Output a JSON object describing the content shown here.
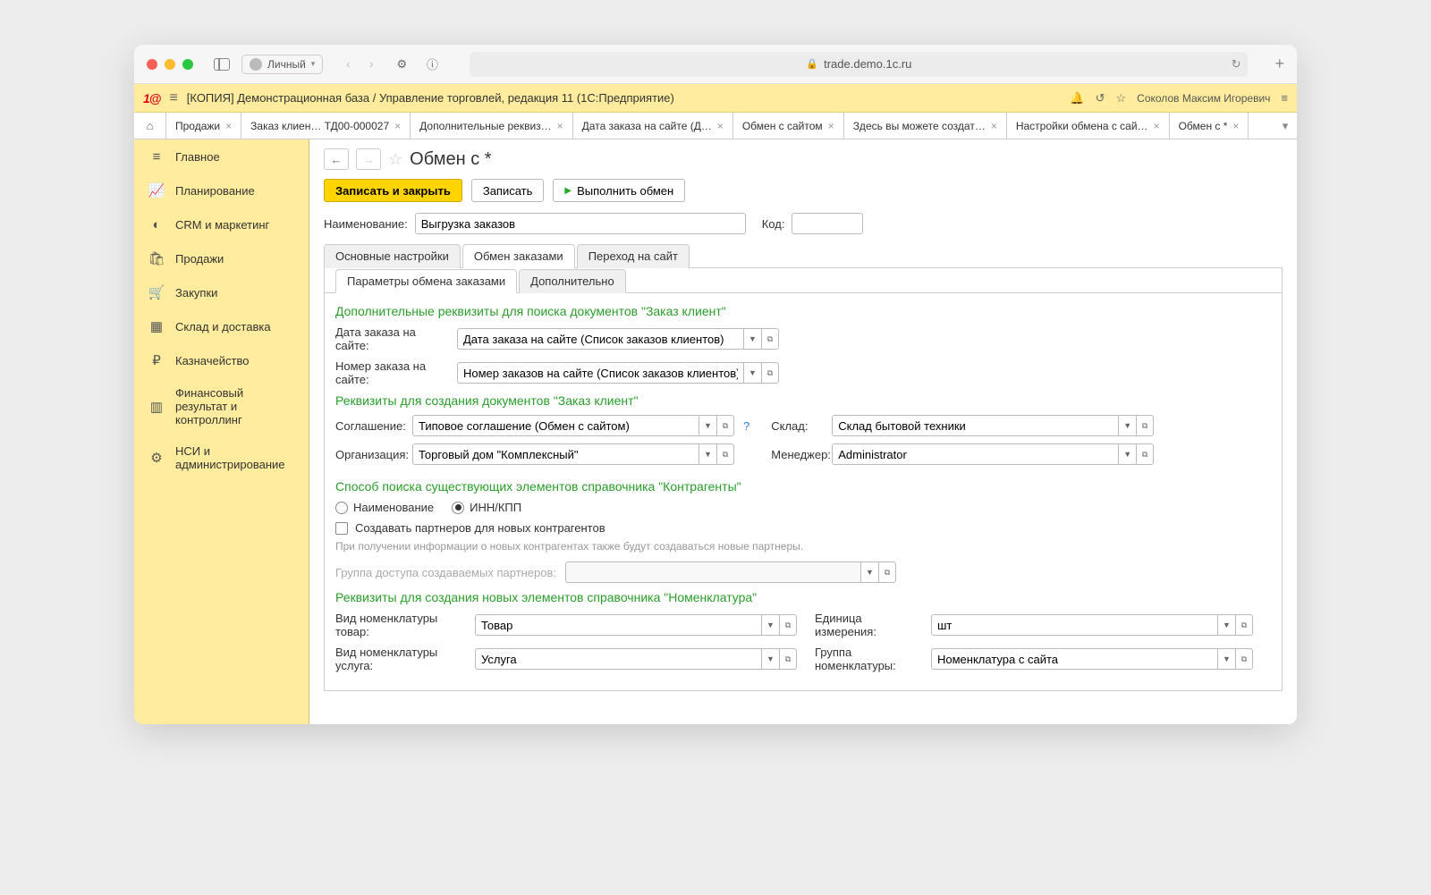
{
  "browser": {
    "profile": "Личный",
    "url": "trade.demo.1c.ru"
  },
  "app_header": {
    "title": "[КОПИЯ] Демонстрационная база / Управление торговлей, редакция 11  (1С:Предприятие)",
    "username": "Соколов Максим Игоревич"
  },
  "doc_tabs": [
    {
      "label": "Продажи",
      "close": true
    },
    {
      "label": "Заказ клиен… ТД00-000027",
      "close": true
    },
    {
      "label": "Дополнительные реквиз…",
      "close": true
    },
    {
      "label": "Дата заказа на сайте (Д…",
      "close": true
    },
    {
      "label": "Обмен с сайтом",
      "close": true
    },
    {
      "label": "Здесь вы можете создат…",
      "close": true
    },
    {
      "label": "Настройки обмена с сай…",
      "close": true
    },
    {
      "label": "Обмен с *",
      "close": true,
      "active": true
    }
  ],
  "sidebar": [
    {
      "icon": "menu",
      "label": "Главное"
    },
    {
      "icon": "chart",
      "label": "Планирование"
    },
    {
      "icon": "pie",
      "label": "CRM и маркетинг"
    },
    {
      "icon": "bag",
      "label": "Продажи"
    },
    {
      "icon": "cart",
      "label": "Закупки"
    },
    {
      "icon": "boxes",
      "label": "Склад и доставка"
    },
    {
      "icon": "ruble",
      "label": "Казначейство"
    },
    {
      "icon": "bars",
      "label": "Финансовый результат и контроллинг"
    },
    {
      "icon": "gear",
      "label": "НСИ и администрирование"
    }
  ],
  "page": {
    "title": "Обмен с  *",
    "btn_save_close": "Записать и закрыть",
    "btn_save": "Записать",
    "btn_run": "Выполнить обмен",
    "name_label": "Наименование:",
    "name_value": "Выгрузка заказов",
    "code_label": "Код:",
    "code_value": ""
  },
  "main_tabs": [
    "Основные настройки",
    "Обмен заказами",
    "Переход на сайт"
  ],
  "sub_tabs": [
    "Параметры обмена заказами",
    "Дополнительно"
  ],
  "sections": {
    "s1_title": "Дополнительные реквизиты для поиска документов \"Заказ клиент\"",
    "date_label": "Дата заказа на сайте:",
    "date_value": "Дата заказа на сайте (Список заказов клиентов)",
    "num_label": "Номер заказа на сайте:",
    "num_value": "Номер заказов на сайте (Список заказов клиентов)",
    "s2_title": "Реквизиты для создания документов \"Заказ клиент\"",
    "agree_label": "Соглашение:",
    "agree_value": "Типовое соглашение (Обмен с сайтом)",
    "sklad_label": "Склад:",
    "sklad_value": "Склад бытовой техники",
    "org_label": "Организация:",
    "org_value": "Торговый дом \"Комплексный\"",
    "mgr_label": "Менеджер:",
    "mgr_value": "Administrator",
    "s3_title": "Способ поиска существующих элементов справочника \"Контрагенты\"",
    "radio1": "Наименование",
    "radio2": "ИНН/КПП",
    "check_label": "Создавать партнеров для новых контрагентов",
    "check_hint": "При получении информации о новых контрагентах также будут создаваться новые партнеры.",
    "group_label": "Группа доступа создаваемых партнеров:",
    "s4_title": "Реквизиты для создания новых элементов справочника \"Номенклатура\"",
    "type_goods_label": "Вид номенклатуры товар:",
    "type_goods_value": "Товар",
    "unit_label": "Единица измерения:",
    "unit_value": "шт",
    "type_serv_label": "Вид номенклатуры услуга:",
    "type_serv_value": "Услуга",
    "nom_group_label": "Группа номенклатуры:",
    "nom_group_value": "Номенклатура с сайта"
  }
}
